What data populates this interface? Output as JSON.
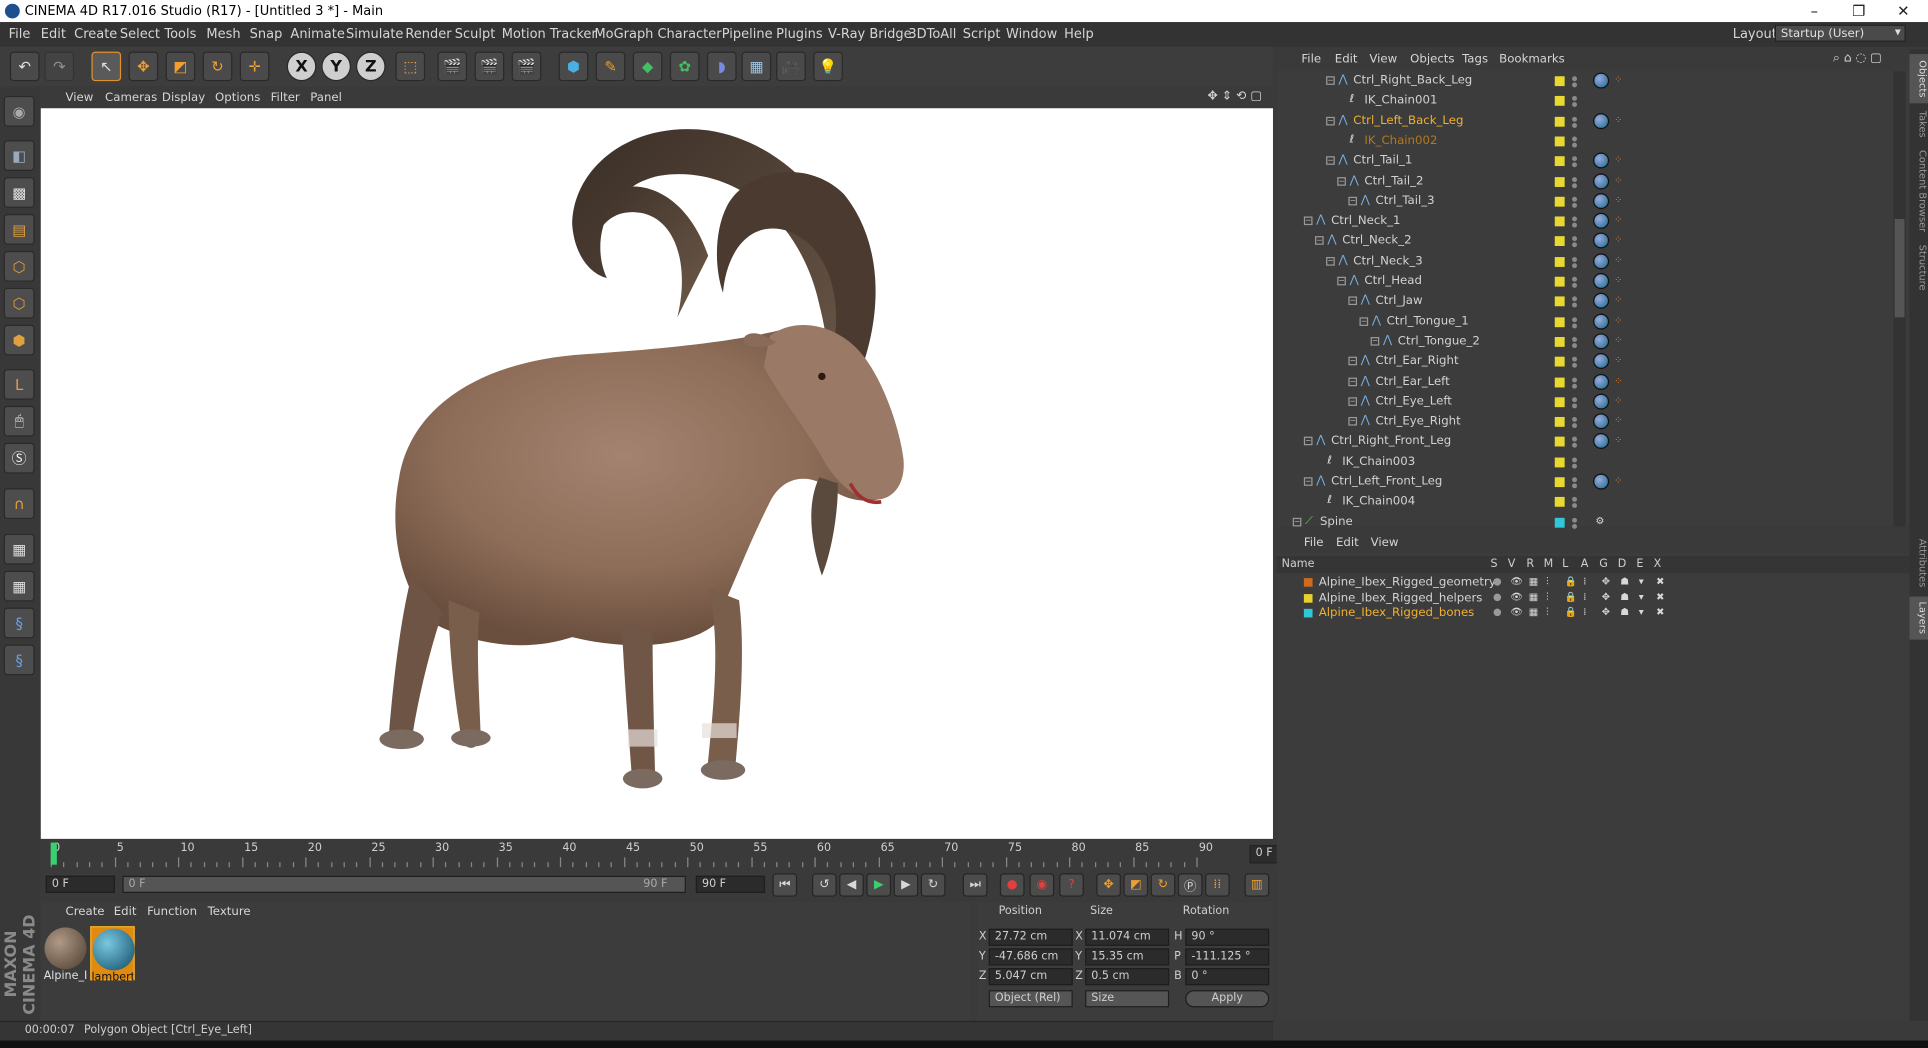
{
  "window": {
    "title": "CINEMA 4D R17.016 Studio (R17) - [Untitled 3 *] - Main",
    "controls": [
      "–",
      "❐",
      "✕"
    ]
  },
  "menubar": [
    "File",
    "Edit",
    "Create",
    "Select",
    "Tools",
    "Mesh",
    "Snap",
    "Animate",
    "Simulate",
    "Render",
    "Sculpt",
    "Motion Tracker",
    "MoGraph",
    "Character",
    "Pipeline",
    "Plugins",
    "V-Ray Bridge",
    "3DToAll",
    "Script",
    "Window",
    "Help"
  ],
  "layout": {
    "label": "Layout:",
    "value": "Startup (User)"
  },
  "viewport_menu": [
    "View",
    "Cameras",
    "Display",
    "Options",
    "Filter",
    "Panel"
  ],
  "timeline": {
    "ticks": [
      "0",
      "5",
      "10",
      "15",
      "20",
      "25",
      "30",
      "35",
      "40",
      "45",
      "50",
      "55",
      "60",
      "65",
      "70",
      "75",
      "80",
      "85",
      "90"
    ],
    "current_frame": "0 F"
  },
  "transport": {
    "start": "0 F",
    "range_start": "0 F",
    "range_end": "90 F",
    "end": "90 F"
  },
  "material_menu": [
    "Create",
    "Edit",
    "Function",
    "Texture"
  ],
  "materials": [
    {
      "label": "Alpine_I",
      "color": "#7a6a5a"
    },
    {
      "label": "lambert",
      "color": "#2c8fb0",
      "selected": true
    }
  ],
  "coords": {
    "headers": [
      "Position",
      "Size",
      "Rotation"
    ],
    "rows": [
      {
        "axis": "X",
        "pos": "27.72 cm",
        "saxis": "X",
        "size": "11.074 cm",
        "raxis": "H",
        "rot": "90 °"
      },
      {
        "axis": "Y",
        "pos": "-47.686 cm",
        "saxis": "Y",
        "size": "15.35 cm",
        "raxis": "P",
        "rot": "-111.125 °"
      },
      {
        "axis": "Z",
        "pos": "5.047 cm",
        "saxis": "Z",
        "size": "0.5 cm",
        "raxis": "B",
        "rot": "0 °"
      }
    ],
    "mode": "Object (Rel)",
    "size_mode": "Size",
    "apply": "Apply"
  },
  "status": {
    "time": "00:00:07",
    "text": "Polygon Object [Ctrl_Eye_Left]"
  },
  "object_menu": [
    "File",
    "Edit",
    "View",
    "Objects",
    "Tags",
    "Bookmarks"
  ],
  "objects": [
    {
      "name": "Ctrl_Right_Back_Leg",
      "indent": 4,
      "type": "joint"
    },
    {
      "name": "IK_Chain001",
      "indent": 5,
      "type": "ik"
    },
    {
      "name": "Ctrl_Left_Back_Leg",
      "indent": 4,
      "type": "joint",
      "hl": "sel"
    },
    {
      "name": "IK_Chain002",
      "indent": 5,
      "type": "ik",
      "hl": "sel2"
    },
    {
      "name": "Ctrl_Tail_1",
      "indent": 4,
      "type": "joint"
    },
    {
      "name": "Ctrl_Tail_2",
      "indent": 5,
      "type": "joint"
    },
    {
      "name": "Ctrl_Tail_3",
      "indent": 6,
      "type": "joint"
    },
    {
      "name": "Ctrl_Neck_1",
      "indent": 2,
      "type": "joint"
    },
    {
      "name": "Ctrl_Neck_2",
      "indent": 3,
      "type": "joint"
    },
    {
      "name": "Ctrl_Neck_3",
      "indent": 4,
      "type": "joint"
    },
    {
      "name": "Ctrl_Head",
      "indent": 5,
      "type": "joint"
    },
    {
      "name": "Ctrl_Jaw",
      "indent": 6,
      "type": "joint"
    },
    {
      "name": "Ctrl_Tongue_1",
      "indent": 7,
      "type": "joint"
    },
    {
      "name": "Ctrl_Tongue_2",
      "indent": 8,
      "type": "joint"
    },
    {
      "name": "Ctrl_Ear_Right",
      "indent": 6,
      "type": "joint"
    },
    {
      "name": "Ctrl_Ear_Left",
      "indent": 6,
      "type": "joint"
    },
    {
      "name": "Ctrl_Eye_Left",
      "indent": 6,
      "type": "joint"
    },
    {
      "name": "Ctrl_Eye_Right",
      "indent": 6,
      "type": "joint"
    },
    {
      "name": "Ctrl_Right_Front_Leg",
      "indent": 2,
      "type": "joint"
    },
    {
      "name": "IK_Chain003",
      "indent": 3,
      "type": "ik"
    },
    {
      "name": "Ctrl_Left_Front_Leg",
      "indent": 2,
      "type": "joint"
    },
    {
      "name": "IK_Chain004",
      "indent": 3,
      "type": "ik"
    },
    {
      "name": "Spine",
      "indent": 1,
      "type": "spline"
    }
  ],
  "right_tabs": [
    "Objects",
    "Takes",
    "Content Browser",
    "Structure",
    "Attributes",
    "Layers"
  ],
  "layer_menu": [
    "File",
    "Edit",
    "View"
  ],
  "layer_columns": [
    "Name",
    "S",
    "V",
    "R",
    "M",
    "L",
    "A",
    "G",
    "D",
    "E",
    "X"
  ],
  "layers": [
    {
      "name": "Alpine_Ibex_Rigged_geometry",
      "color": "#d06a20"
    },
    {
      "name": "Alpine_Ibex_Rigged_helpers",
      "color": "#e8d030"
    },
    {
      "name": "Alpine_Ibex_Rigged_bones",
      "color": "#30c8d8",
      "hl": true
    }
  ]
}
